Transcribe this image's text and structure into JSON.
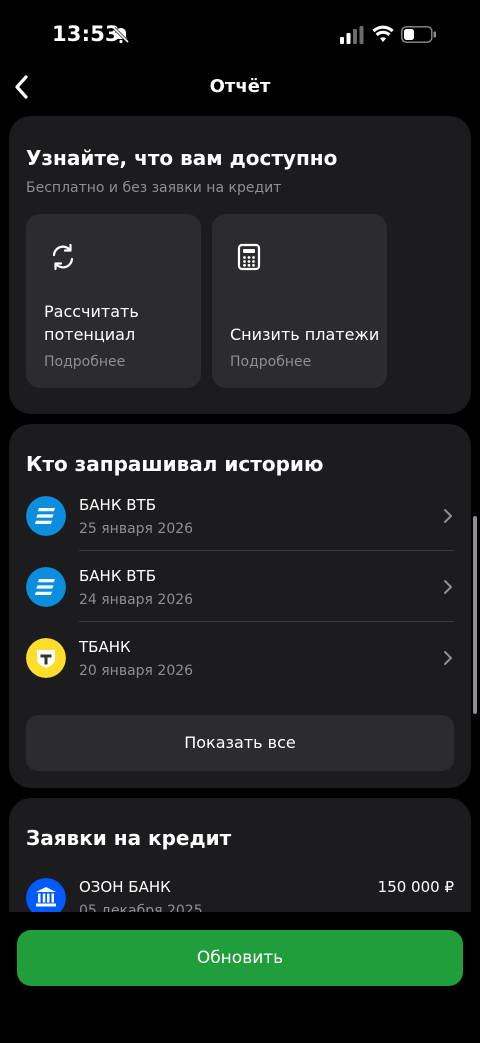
{
  "status": {
    "time": "13:53"
  },
  "nav": {
    "title": "Отчёт"
  },
  "discover": {
    "title": "Узнайте, что вам доступно",
    "subtitle": "Бесплатно и без заявки на кредит",
    "tiles": [
      {
        "label": "Рассчитать потенциал",
        "more": "Подробнее",
        "icon": "refresh-icon"
      },
      {
        "label": "Снизить платежи",
        "more": "Подробнее",
        "icon": "calculator-icon"
      }
    ]
  },
  "history": {
    "title": "Кто запрашивал историю",
    "items": [
      {
        "name": "БАНК ВТБ",
        "date": "25 января 2026",
        "logo": "vtb-logo"
      },
      {
        "name": "БАНК ВТБ",
        "date": "24 января 2026",
        "logo": "vtb-logo"
      },
      {
        "name": "ТБАНК",
        "date": "20 января 2026",
        "logo": "tbank-logo"
      }
    ],
    "show_all": "Показать все"
  },
  "applications": {
    "title": "Заявки на кредит",
    "items": [
      {
        "name": "ОЗОН БАНК",
        "date": "05 декабря 2025",
        "amount": "150 000 ₽",
        "logo": "bank-icon"
      }
    ]
  },
  "footer": {
    "refresh_label": "Обновить"
  },
  "colors": {
    "accent_green": "#1f9e3b",
    "card_bg": "#1c1c1e",
    "tile_bg": "#2c2c2e",
    "vtb_blue": "#0b8ede",
    "tbank_yellow": "#ffdd2d",
    "ozon_blue": "#005bff"
  }
}
